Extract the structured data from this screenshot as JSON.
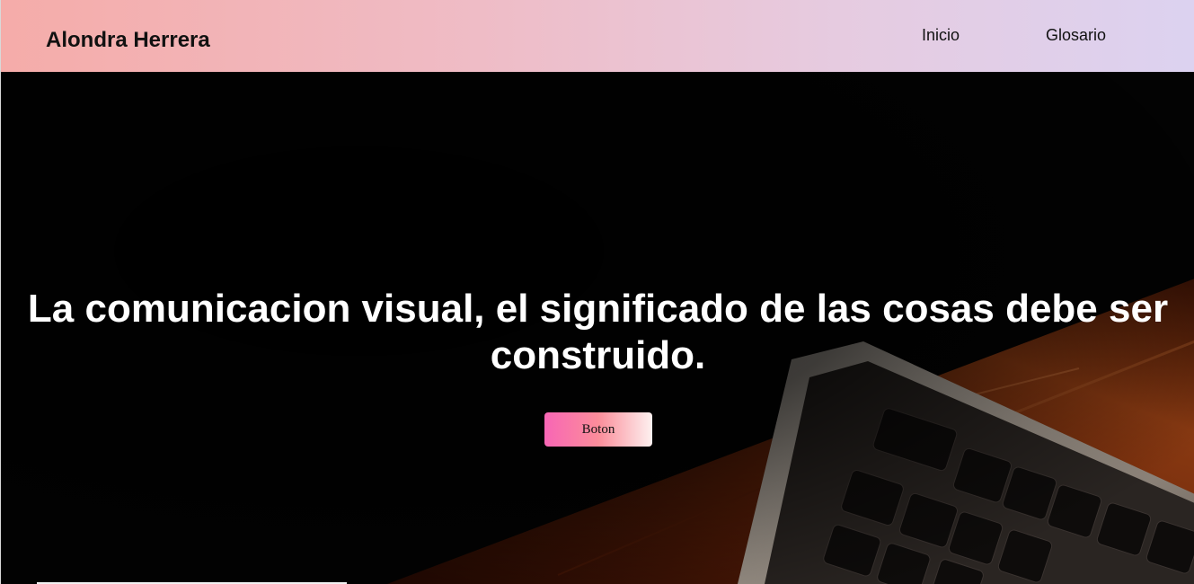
{
  "header": {
    "brand": "Alondra Herrera",
    "nav": {
      "inicio": "Inicio",
      "glosario": "Glosario"
    }
  },
  "hero": {
    "title": "La comunicacion visual, el significado de las cosas debe ser construido.",
    "button_label": "Boton",
    "background_image": "laptop-keyboard-on-wooden-desk-photo"
  },
  "colors": {
    "header_gradient_start": "#f5aca9",
    "header_gradient_end": "#dcd2f0",
    "button_gradient_start": "#f866b5",
    "button_gradient_end": "#fdf1f0",
    "hero_text": "#ffffff"
  }
}
